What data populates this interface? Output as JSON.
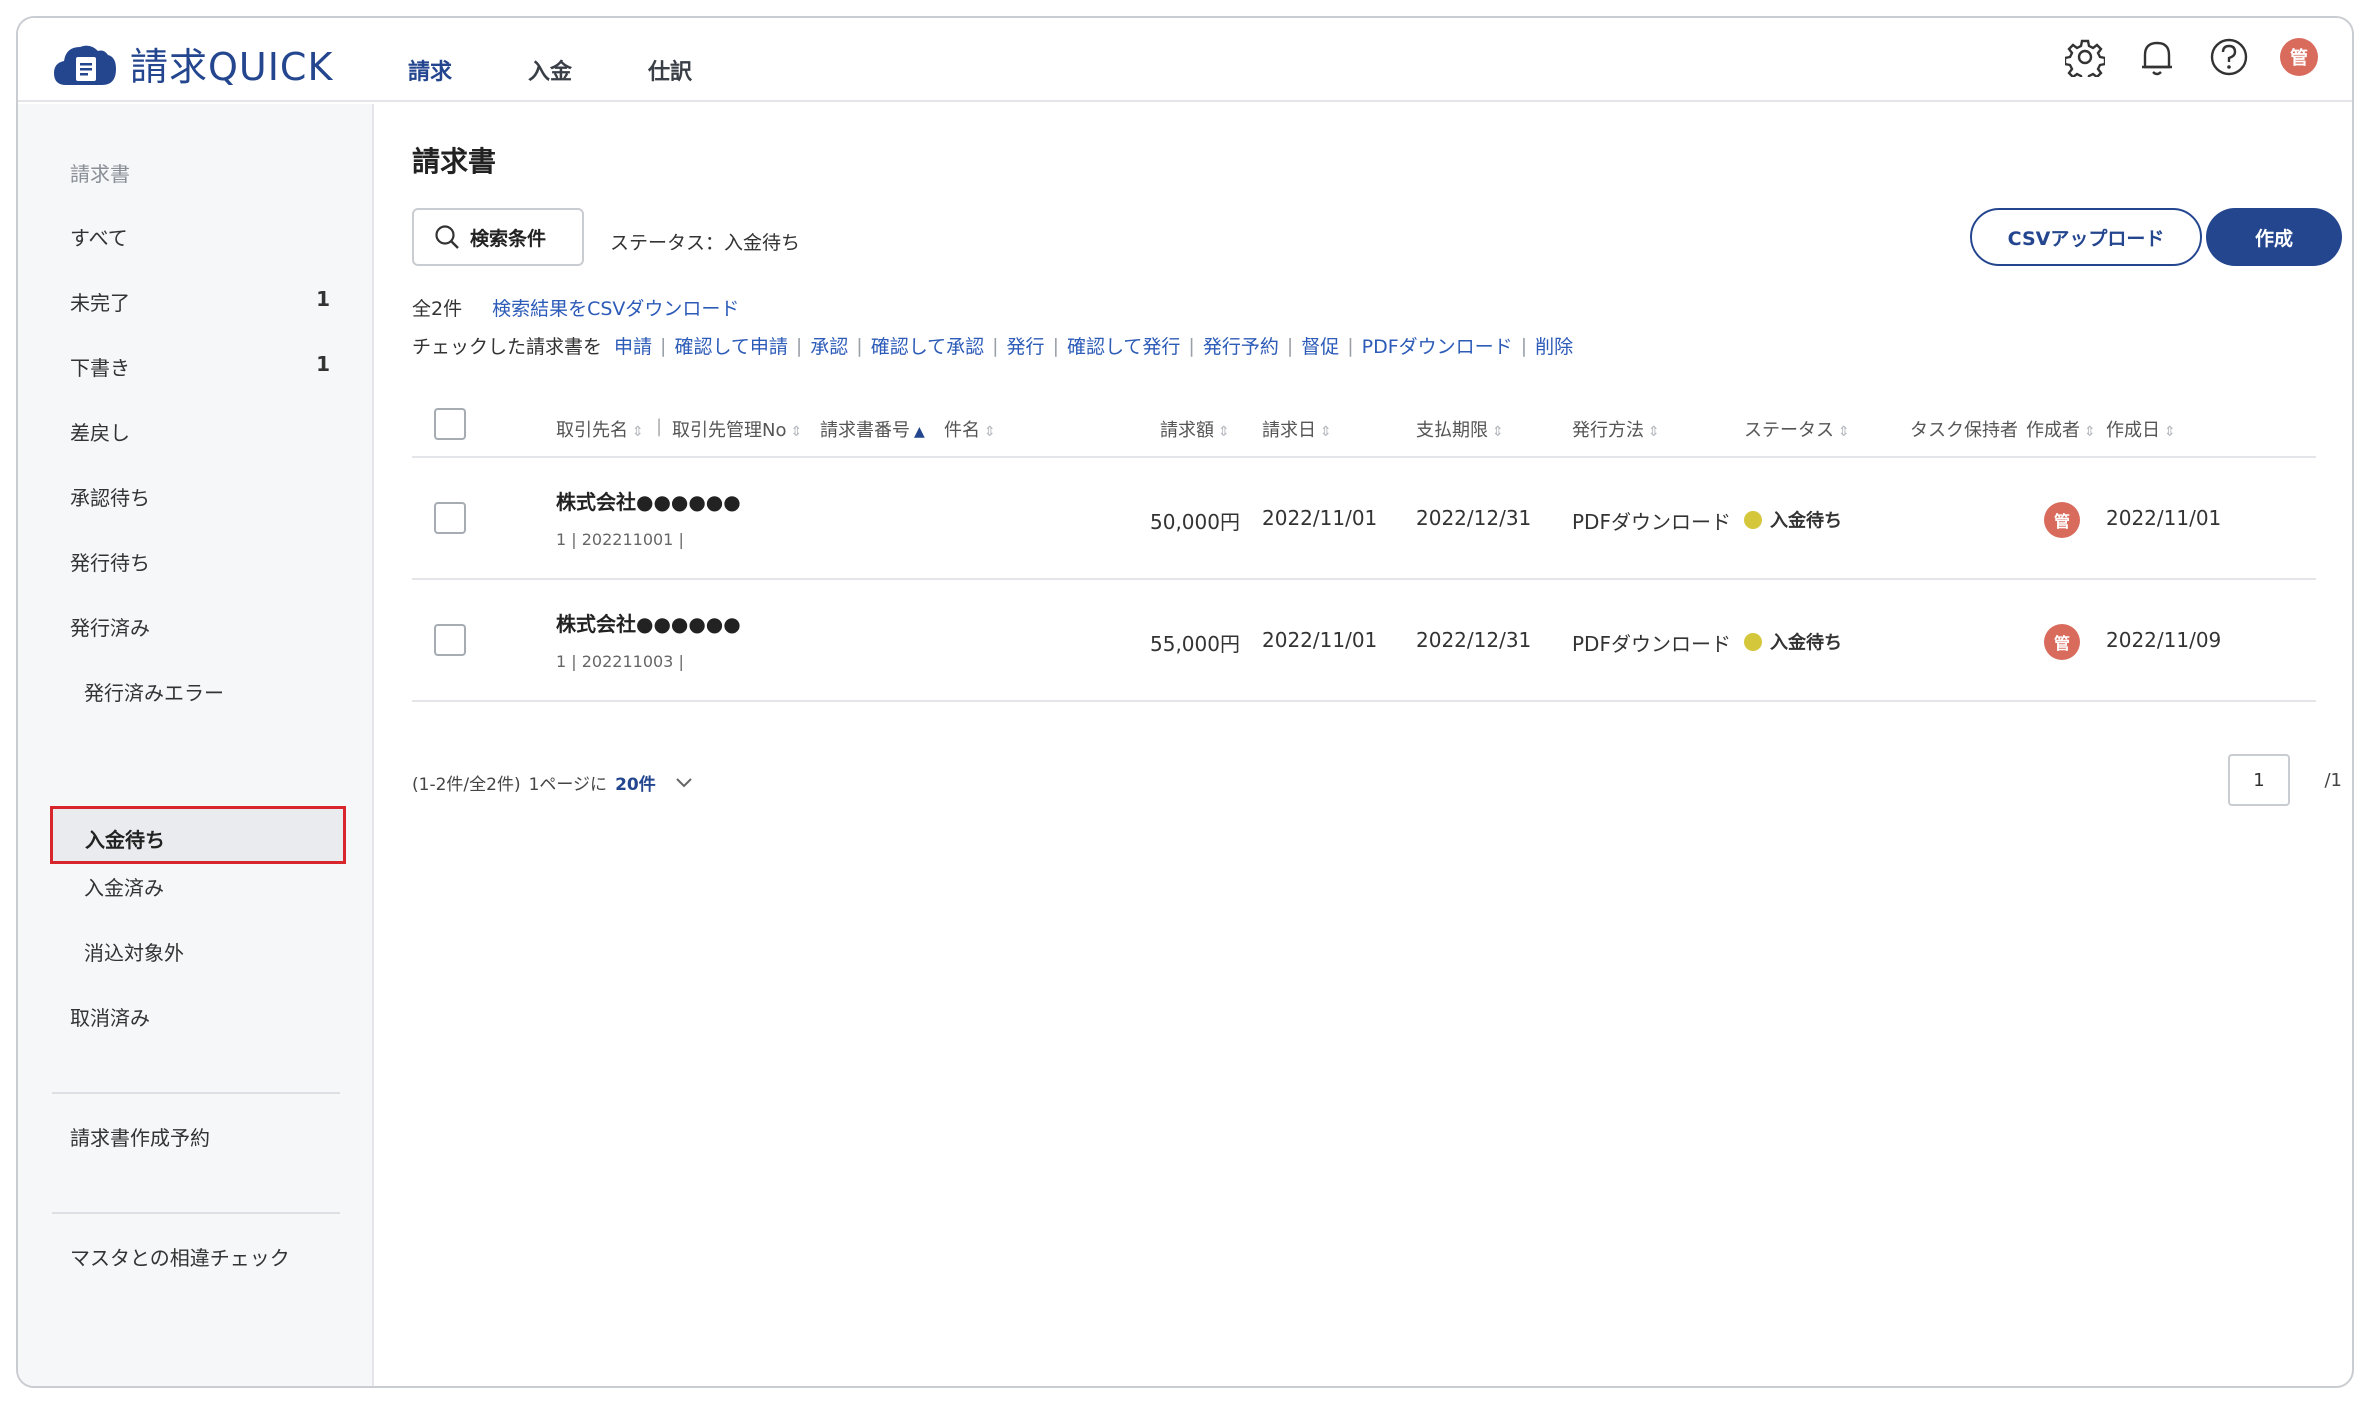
{
  "app": {
    "name": "請求QUICK"
  },
  "topnav": [
    "請求",
    "入金",
    "仕訳"
  ],
  "user": {
    "initial": "管"
  },
  "sidebar": {
    "section": "請求書",
    "items": [
      {
        "label": "すべて",
        "count": ""
      },
      {
        "label": "未完了",
        "count": "1"
      },
      {
        "label": "下書き",
        "count": "1"
      },
      {
        "label": "差戻し",
        "count": ""
      },
      {
        "label": "承認待ち",
        "count": ""
      },
      {
        "label": "発行待ち",
        "count": ""
      },
      {
        "label": "発行済み",
        "count": ""
      }
    ],
    "sub_items": [
      "発行済みエラー",
      "入金待ち",
      "入金済み",
      "消込対象外"
    ],
    "cancelled": "取消済み",
    "reservation": "請求書作成予約",
    "master_check": "マスタとの相違チェック"
  },
  "main": {
    "title": "請求書",
    "search_label": "検索条件",
    "status_filter": "ステータス：入金待ち",
    "csv_upload": "CSVアップロード",
    "create": "作成",
    "total": "全2件",
    "csv_download": "検索結果をCSVダウンロード",
    "action_prefix": "チェックした請求書を",
    "actions": [
      "申請",
      "確認して申請",
      "承認",
      "確認して承認",
      "発行",
      "確認して発行",
      "発行予約",
      "督促",
      "PDFダウンロード",
      "削除"
    ]
  },
  "table": {
    "headers": {
      "client": "取引先名",
      "client_no": "取引先管理No",
      "invoice_no": "請求書番号",
      "subject": "件名",
      "amount": "請求額",
      "date": "請求日",
      "due": "支払期限",
      "method": "発行方法",
      "status": "ステータス",
      "task": "タスク保持者",
      "creator": "作成者",
      "created": "作成日"
    },
    "rows": [
      {
        "client": "株式会社●●●●●●",
        "sub": "1 | 202211001 |",
        "amount": "50,000円",
        "date": "2022/11/01",
        "due": "2022/12/31",
        "method": "PDFダウンロード",
        "status": "入金待ち",
        "creator": "管",
        "created": "2022/11/01"
      },
      {
        "client": "株式会社●●●●●●",
        "sub": "1 | 202211003 |",
        "amount": "55,000円",
        "date": "2022/11/01",
        "due": "2022/12/31",
        "method": "PDFダウンロード",
        "status": "入金待ち",
        "creator": "管",
        "created": "2022/11/09"
      }
    ]
  },
  "pagination": {
    "range": "(1-2件/全2件)",
    "per_page_label": "1ページに",
    "per_page": "20件",
    "page": "1",
    "total_pages": "/1"
  },
  "colors": {
    "brand": "#24468f",
    "status_dot": "#d4c73b",
    "highlight": "#d7262c",
    "avatar": "#d96b5d"
  }
}
